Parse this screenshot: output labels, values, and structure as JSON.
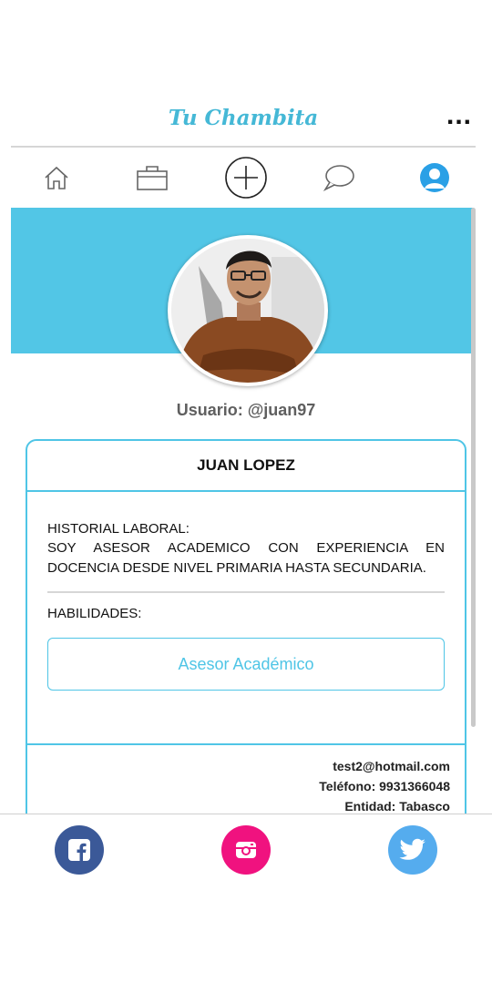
{
  "header": {
    "title": "Tu Chambita",
    "menu_label": "..."
  },
  "nav": {
    "items": [
      {
        "name": "home",
        "icon": "home-icon"
      },
      {
        "name": "jobs",
        "icon": "briefcase-icon"
      },
      {
        "name": "add",
        "icon": "plus-circle-icon"
      },
      {
        "name": "messages",
        "icon": "chat-bubble-icon"
      },
      {
        "name": "profile",
        "icon": "user-icon",
        "active": true
      }
    ]
  },
  "profile": {
    "username": "Usuario: @juan97",
    "full_name": "JUAN LOPEZ",
    "history_label": "HISTORIAL LABORAL:",
    "history_text": "SOY ASESOR ACADEMICO CON EXPERIENCIA EN DOCENCIA DESDE NIVEL PRIMARIA HASTA SECUNDARIA.",
    "skills_label": "HABILIDADES:",
    "skills": [
      "Asesor Académico"
    ],
    "email": "test2@hotmail.com",
    "phone": "Teléfono: 9931366048",
    "entity": "Entidad: Tabasco"
  },
  "social": [
    {
      "name": "facebook",
      "icon": "facebook-icon",
      "color": "#3b5998"
    },
    {
      "name": "instagram",
      "icon": "instagram-icon",
      "color": "#f0127f"
    },
    {
      "name": "twitter",
      "icon": "twitter-icon",
      "color": "#55acee"
    }
  ],
  "colors": {
    "accent": "#52c6e6",
    "brand_title": "#45b8d6"
  }
}
